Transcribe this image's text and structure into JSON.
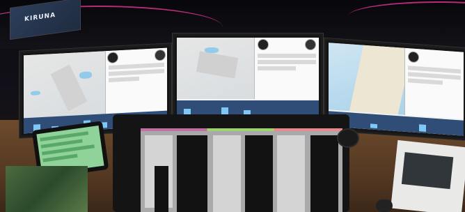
{
  "scene": {
    "description": "",
    "sign_text": "KIRUNA",
    "accent_color": "#d8328e",
    "monitor_count": 3,
    "icons": [
      "compass-icon"
    ]
  }
}
